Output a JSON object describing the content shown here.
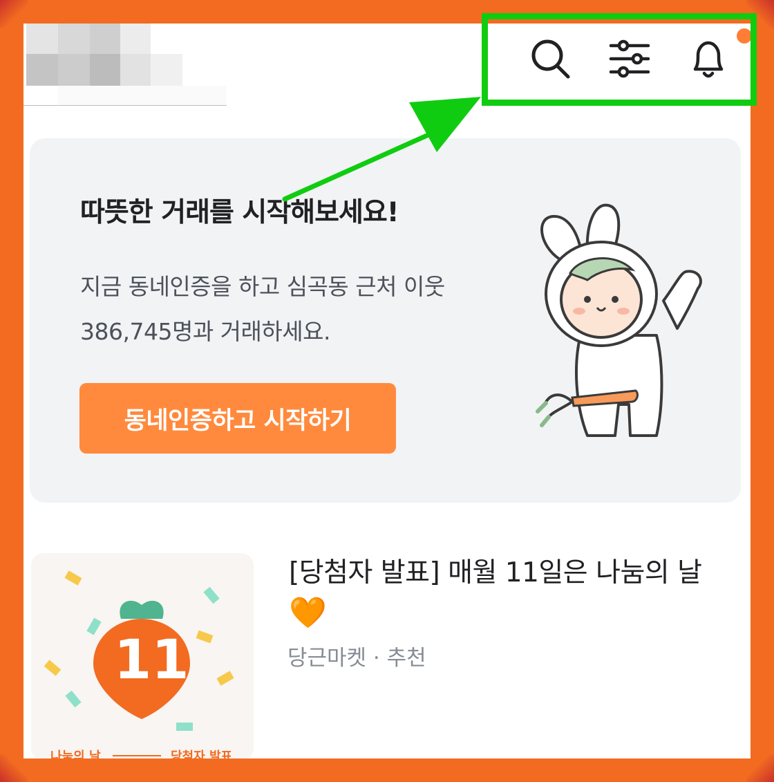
{
  "header": {
    "icons": [
      "search-icon",
      "filter-icon",
      "bell-icon"
    ],
    "notification_dot_color": "#ff7e36"
  },
  "banner": {
    "title": "따뜻한 거래를 시작해보세요!",
    "description_line1": "지금 동네인증을 하고 심곡동 근처 이웃",
    "description_line2": "386,745명과 거래하세요.",
    "cta_label": "동네인증하고 시작하기"
  },
  "article": {
    "title_text": "[당첨자 발표] 매월 11일은 나눔의 날",
    "title_emoji": "🧡",
    "meta": "당근마켓 · 추천",
    "thumbnail": {
      "number": "11",
      "caption_left": "나눔의 날",
      "caption_right": "당첨자 발표"
    }
  },
  "annotation": {
    "box_color": "#10cc10",
    "frame_color": "#f26b21"
  },
  "colors": {
    "accent": "#ff8a3d",
    "text_primary": "#212124",
    "text_secondary": "#868b94"
  }
}
